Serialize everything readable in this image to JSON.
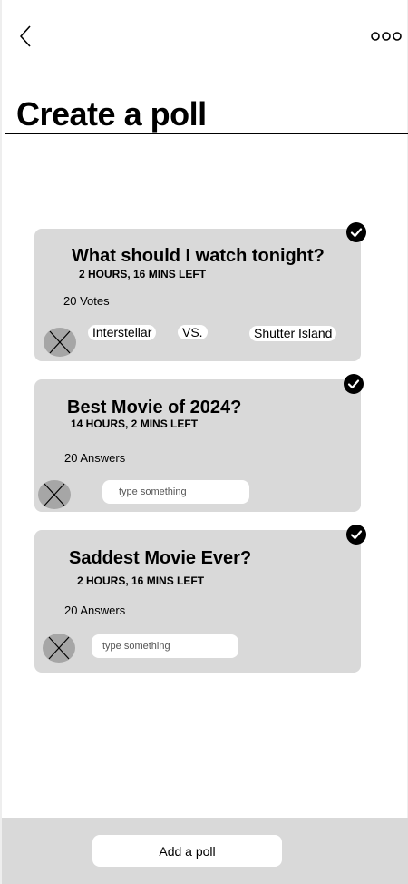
{
  "header": {
    "back_icon": "chevron-left-icon",
    "more_icon": "more-horizontal-icon",
    "title": "Create a poll"
  },
  "polls": [
    {
      "question": "What should I watch tonight?",
      "time_left": "2 HOURS, 16 MINS LEFT",
      "count_label": "20 Votes",
      "option_a": "Interstellar",
      "vs_label": "VS.",
      "option_b": "Shutter Island",
      "checked": true
    },
    {
      "question": "Best Movie of 2024?",
      "time_left": "14 HOURS, 2 MINS LEFT",
      "count_label": "20 Answers",
      "input_placeholder": "type something",
      "checked": true
    },
    {
      "question": "Saddest Movie Ever?",
      "time_left": "2 HOURS, 16 MINS LEFT",
      "count_label": "20 Answers",
      "input_placeholder": "type something",
      "checked": true
    }
  ],
  "footer": {
    "add_poll_label": "Add a poll"
  },
  "colors": {
    "card_bg": "#d9d9d9",
    "avatar_bg": "#a6a6a6",
    "check_bg": "#000000",
    "footer_bg": "#d9d9d9"
  }
}
